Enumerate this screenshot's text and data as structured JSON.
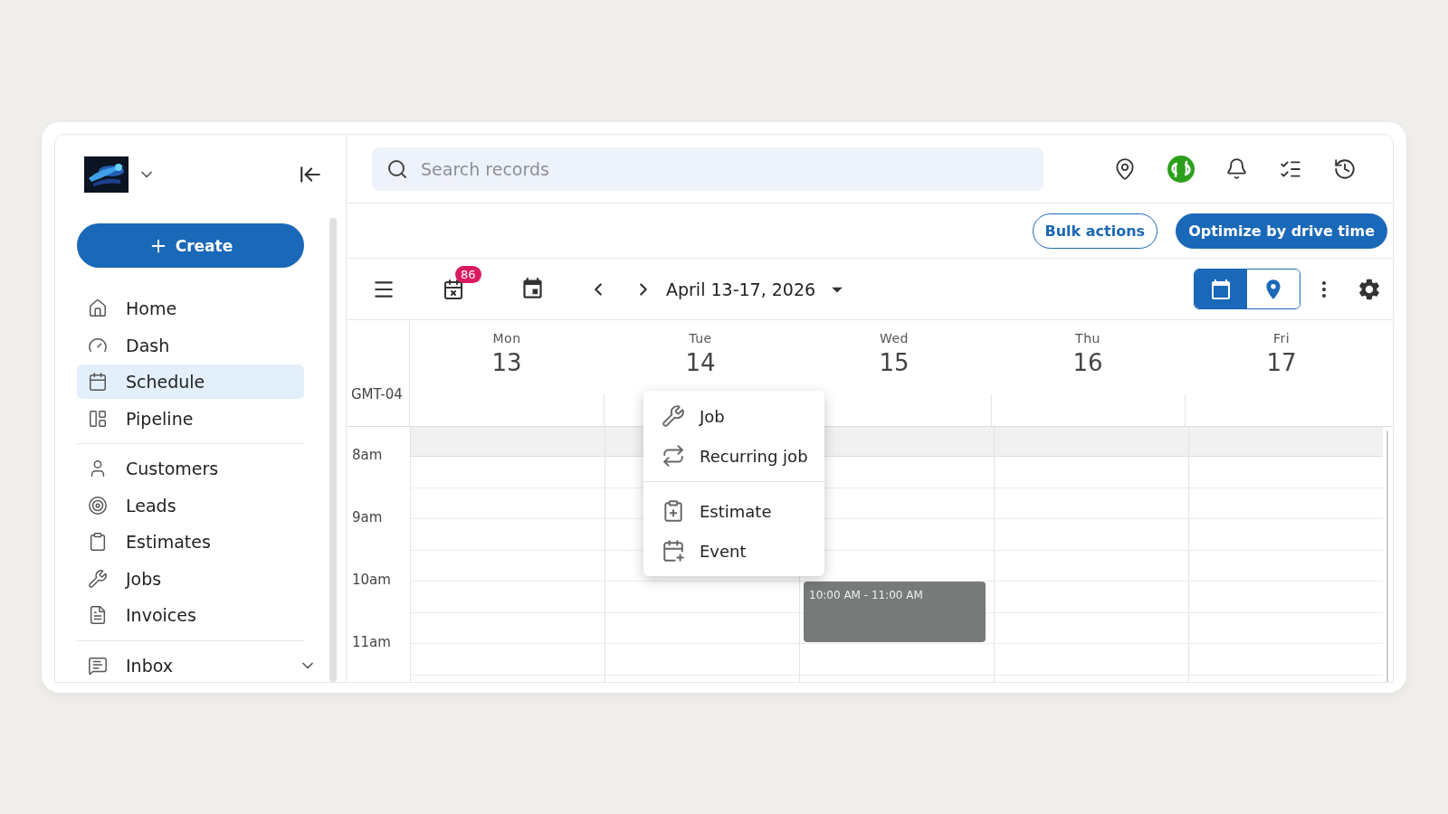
{
  "sidebar": {
    "create_label": "Create",
    "nav_groups": [
      [
        {
          "kind": "home",
          "label": "Home",
          "selected": false
        },
        {
          "kind": "dash",
          "label": "Dash",
          "selected": false
        },
        {
          "kind": "schedule",
          "label": "Schedule",
          "selected": true
        },
        {
          "kind": "pipeline",
          "label": "Pipeline",
          "selected": false
        }
      ],
      [
        {
          "kind": "customers",
          "label": "Customers",
          "selected": false
        },
        {
          "kind": "leads",
          "label": "Leads",
          "selected": false
        },
        {
          "kind": "estimates",
          "label": "Estimates",
          "selected": false
        },
        {
          "kind": "jobs",
          "label": "Jobs",
          "selected": false
        },
        {
          "kind": "invoices",
          "label": "Invoices",
          "selected": false
        }
      ]
    ],
    "inbox": {
      "label": "Inbox"
    }
  },
  "search": {
    "placeholder": "Search records"
  },
  "actions": [
    {
      "kind": "outline",
      "label": "Bulk actions"
    },
    {
      "kind": "primary",
      "label": "Optimize by drive time"
    }
  ],
  "toolbar": {
    "badge": "86",
    "date_range": "April 13-17, 2026",
    "views": [
      {
        "kind": "calendar",
        "selected": true
      },
      {
        "kind": "map",
        "selected": false
      }
    ]
  },
  "calendar": {
    "timezone": "GMT-04",
    "hours": [
      "8am",
      "9am",
      "10am",
      "11am"
    ],
    "days": [
      {
        "weekday": "Mon",
        "date": "13"
      },
      {
        "weekday": "Tue",
        "date": "14"
      },
      {
        "weekday": "Wed",
        "date": "15",
        "events": [
          {
            "time": "10:00 AM - 11:00 AM"
          }
        ]
      },
      {
        "weekday": "Thu",
        "date": "16"
      },
      {
        "weekday": "Fri",
        "date": "17"
      }
    ]
  },
  "context_menu": {
    "groups": [
      [
        {
          "kind": "job",
          "label": "Job"
        },
        {
          "kind": "recurring",
          "label": "Recurring job"
        }
      ],
      [
        {
          "kind": "estimate",
          "label": "Estimate"
        },
        {
          "kind": "event",
          "label": "Event"
        }
      ]
    ]
  }
}
